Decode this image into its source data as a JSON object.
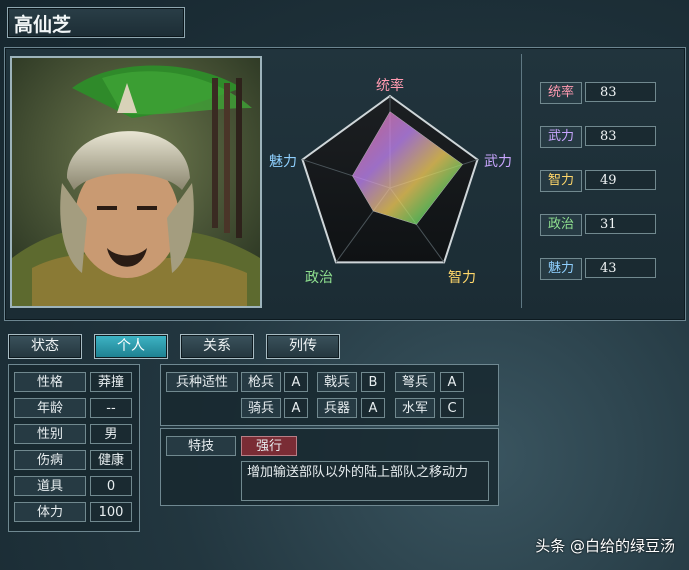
{
  "character": {
    "name": "高仙芝"
  },
  "radar": {
    "labels": {
      "leadership": "统率",
      "war": "武力",
      "intelligence": "智力",
      "politics": "政治",
      "charm": "魅力"
    },
    "values": {
      "leadership": 83,
      "war": 83,
      "intelligence": 49,
      "politics": 31,
      "charm": 43
    },
    "max": 100
  },
  "stats": [
    {
      "label": "统率",
      "value": "83",
      "color": "#ff9ab0"
    },
    {
      "label": "武力",
      "value": "83",
      "color": "#c9a6ff"
    },
    {
      "label": "智力",
      "value": "49",
      "color": "#ffd76a"
    },
    {
      "label": "政治",
      "value": "31",
      "color": "#8fe08f"
    },
    {
      "label": "魅力",
      "value": "43",
      "color": "#8fd0ff"
    }
  ],
  "tabs": [
    {
      "label": "状态",
      "active": false
    },
    {
      "label": "个人",
      "active": true
    },
    {
      "label": "关系",
      "active": false
    },
    {
      "label": "列传",
      "active": false
    }
  ],
  "personal": [
    {
      "label": "性格",
      "value": "莽撞"
    },
    {
      "label": "年龄",
      "value": "--"
    },
    {
      "label": "性别",
      "value": "男"
    },
    {
      "label": "伤病",
      "value": "健康"
    },
    {
      "label": "道具",
      "value": "0"
    },
    {
      "label": "体力",
      "value": "100"
    }
  ],
  "aptitude": {
    "title": "兵种适性",
    "rows": [
      [
        {
          "unit": "枪兵",
          "grade": "A"
        },
        {
          "unit": "戟兵",
          "grade": "B"
        },
        {
          "unit": "弩兵",
          "grade": "A"
        }
      ],
      [
        {
          "unit": "骑兵",
          "grade": "A"
        },
        {
          "unit": "兵器",
          "grade": "A"
        },
        {
          "unit": "水军",
          "grade": "C"
        }
      ]
    ]
  },
  "skill": {
    "title": "特技",
    "name": "强行",
    "description": "增加输送部队以外的陆上部队之移动力"
  },
  "watermark": "头条 @白给的绿豆汤",
  "colors": {
    "accent": "#2fa8ba",
    "skill_badge": "#7a2c35"
  }
}
